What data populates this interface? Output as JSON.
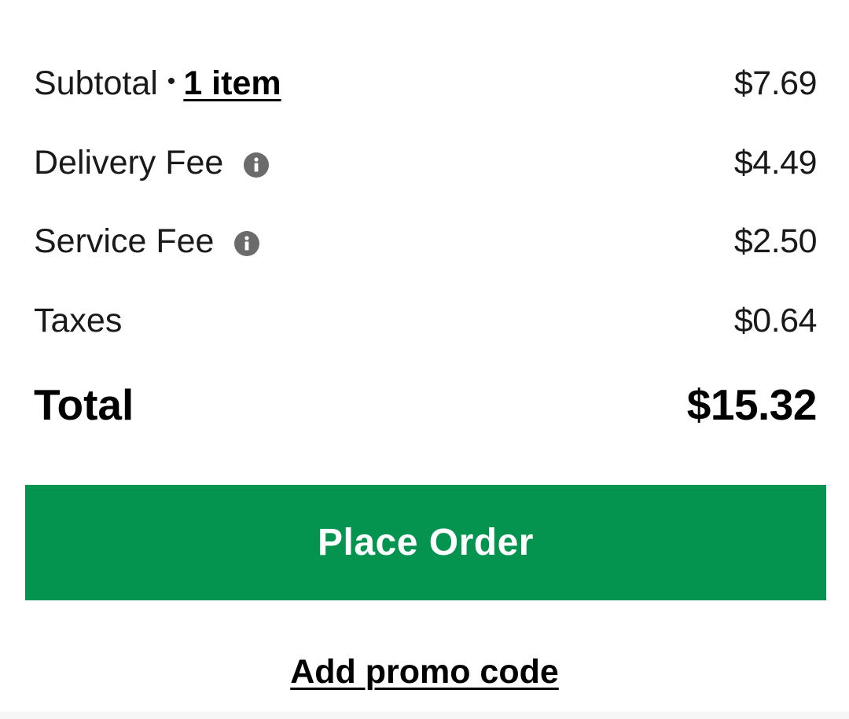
{
  "summary": {
    "subtotal": {
      "label": "Subtotal",
      "separator": "•",
      "items_link": "1 item",
      "amount": "$7.69"
    },
    "delivery_fee": {
      "label": "Delivery Fee",
      "icon": "info-icon",
      "amount": "$4.49"
    },
    "service_fee": {
      "label": "Service Fee",
      "icon": "info-icon",
      "amount": "$2.50"
    },
    "taxes": {
      "label": "Taxes",
      "amount": "$0.64"
    },
    "total": {
      "label": "Total",
      "amount": "$15.32"
    }
  },
  "actions": {
    "place_order_label": "Place Order",
    "promo_label": "Add promo code"
  },
  "colors": {
    "accent": "#05944f",
    "text": "#1a1a1a",
    "icon": "#6b6b6b",
    "background": "#ffffff"
  }
}
